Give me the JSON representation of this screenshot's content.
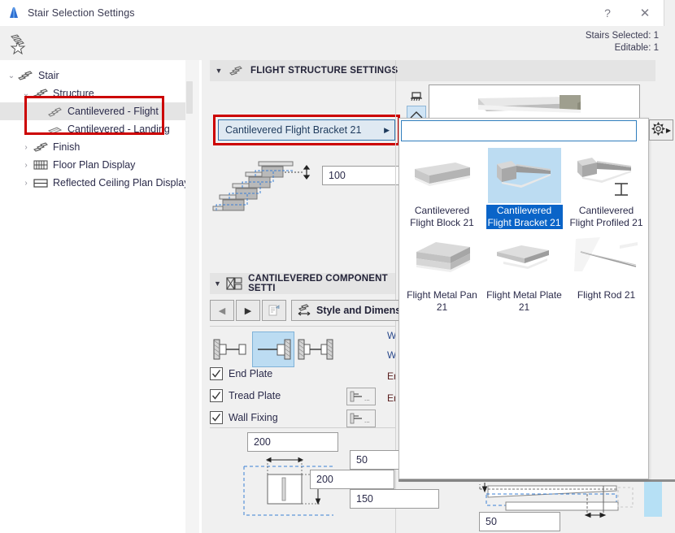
{
  "window": {
    "title": "Stair Selection Settings",
    "app_icon": "stair-app-icon",
    "help_label": "?",
    "close_label": "✕"
  },
  "subtoolbar": {
    "favorites_icon": "favorites-star-icon",
    "stairs_selected_label": "Stairs Selected: 1",
    "editable_label": "Editable: 1"
  },
  "sidebar": {
    "items": [
      {
        "label": "Stair",
        "icon": "stair-icon",
        "level": 0,
        "twisty": "⌄",
        "expanded": true,
        "selected": false
      },
      {
        "label": "Structure",
        "icon": "structure-icon",
        "level": 1,
        "twisty": "⌄",
        "expanded": true,
        "selected": false
      },
      {
        "label": "Cantilevered - Flight",
        "icon": "cantilevered-flight-icon",
        "level": 2,
        "twisty": "",
        "expanded": false,
        "selected": true
      },
      {
        "label": "Cantilevered - Landing",
        "icon": "cantilevered-landing-icon",
        "level": 2,
        "twisty": "",
        "expanded": false,
        "selected": false
      },
      {
        "label": "Finish",
        "icon": "finish-icon",
        "level": 1,
        "twisty": "›",
        "expanded": false,
        "selected": false
      },
      {
        "label": "Floor Plan Display",
        "icon": "floor-plan-display-icon",
        "level": 1,
        "twisty": "›",
        "expanded": false,
        "selected": false
      },
      {
        "label": "Reflected Ceiling Plan Display",
        "icon": "reflected-ceiling-plan-icon",
        "level": 1,
        "twisty": "›",
        "expanded": false,
        "selected": false
      }
    ]
  },
  "flight_structure": {
    "header": "FLIGHT STRUCTURE SETTINGS",
    "header_icon": "flight-structure-icon",
    "caret": "▼",
    "structure_combo_value": "Cantilevered Flight Bracket 21",
    "combo_arrow": "▶",
    "offset_value": "100",
    "stair_diagram": "cantilevered-stair-profile-diagram"
  },
  "picker_popup": {
    "search_value": "",
    "search_placeholder": "",
    "gear_icon": "gear-icon",
    "gear_arrow": "▶",
    "items": [
      {
        "label": "Cantilevered Flight Block 21",
        "thumb": "flight-block-thumb",
        "selected": false
      },
      {
        "label": "Cantilevered Flight Bracket 21",
        "thumb": "flight-bracket-thumb",
        "selected": true
      },
      {
        "label": "Cantilevered Flight Profiled 21",
        "thumb": "flight-profiled-thumb",
        "selected": false
      },
      {
        "label": "Flight Metal Pan 21",
        "thumb": "flight-metal-pan-thumb",
        "selected": false
      },
      {
        "label": "Flight Metal Plate 21",
        "thumb": "flight-metal-plate-thumb",
        "selected": false
      },
      {
        "label": "Flight Rod 21",
        "thumb": "flight-rod-thumb",
        "selected": false
      }
    ]
  },
  "preview": {
    "model_thumb": "bracket-3d-preview",
    "view_icons": [
      {
        "name": "3d-view-icon",
        "active": false
      },
      {
        "name": "section-view-icon",
        "active": true
      }
    ]
  },
  "component_settings": {
    "header": "CANTILEVERED COMPONENT SETTI",
    "header_icon": "component-settings-icon",
    "caret": "▼",
    "nav_prev": "◀",
    "nav_next": "▶",
    "nav_edit_icon": "edit-document-icon",
    "style_button_label": "Style and Dimensions.",
    "style_button_icon": "style-dimensions-icon",
    "structure_options": [
      {
        "name": "bracket-both-ends-icon",
        "selected": false
      },
      {
        "name": "bracket-right-fixed-icon",
        "selected": true
      },
      {
        "name": "bracket-spanning-icon",
        "selected": false
      }
    ],
    "checkboxes": [
      {
        "label": "End Plate",
        "checked": true,
        "has_button": false
      },
      {
        "label": "Tread Plate",
        "checked": true,
        "has_button": true,
        "button_icon": "tread-plate-settings-icon"
      },
      {
        "label": "Wall Fixing",
        "checked": true,
        "has_button": true,
        "button_icon": "wall-fixing-settings-icon"
      }
    ],
    "truncated_labels": [
      "W",
      "W",
      "En",
      "En"
    ]
  },
  "dimensions": {
    "fields": [
      {
        "name": "bracket-width-field",
        "value": "200"
      },
      {
        "name": "bracket-thickness-field",
        "value": "50"
      },
      {
        "name": "bracket-height-field",
        "value": "200"
      },
      {
        "name": "bracket-depth-field",
        "value": "150"
      },
      {
        "name": "plate-thickness-field",
        "value": "50"
      }
    ],
    "diagram_left": "bracket-section-diagram",
    "diagram_right": "bracket-plan-diagram"
  },
  "colors": {
    "accent_blue": "#0a64c8",
    "highlight_red": "#cc0000",
    "selection_blue": "#bcdcf2",
    "panel_gray": "#f0f0f0",
    "section_header_gray": "#e4e4e4",
    "scrollbar_blue": "#b6e0f5"
  }
}
